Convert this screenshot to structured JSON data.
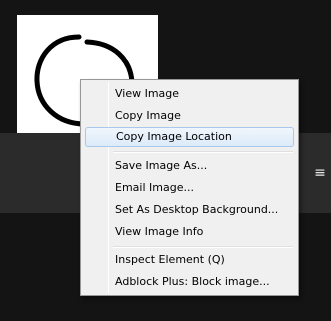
{
  "context_menu": {
    "items": [
      {
        "label": "View Image",
        "name": "menu-item-view-image"
      },
      {
        "label": "Copy Image",
        "name": "menu-item-copy-image"
      },
      {
        "label": "Copy Image Location",
        "name": "menu-item-copy-image-location",
        "highlighted": true
      },
      {
        "label": "Save Image As...",
        "name": "menu-item-save-image-as"
      },
      {
        "label": "Email Image...",
        "name": "menu-item-email-image"
      },
      {
        "label": "Set As Desktop Background...",
        "name": "menu-item-set-as-desktop-background"
      },
      {
        "label": "View Image Info",
        "name": "menu-item-view-image-info"
      },
      {
        "label": "Inspect Element (Q)",
        "name": "menu-item-inspect-element"
      },
      {
        "label": "Adblock Plus: Block image...",
        "name": "menu-item-adblock-block-image"
      }
    ]
  },
  "toolbar": {
    "menu_icon": "hamburger-menu-icon",
    "menu_glyph": "≡"
  },
  "image": {
    "subject": "hand-drawn-ellipse"
  },
  "colors": {
    "menu_background": "#f0f0f0",
    "highlight_border": "#a8c8ec",
    "page_background": "#141414",
    "toolbar_background": "#2b2b2b"
  }
}
